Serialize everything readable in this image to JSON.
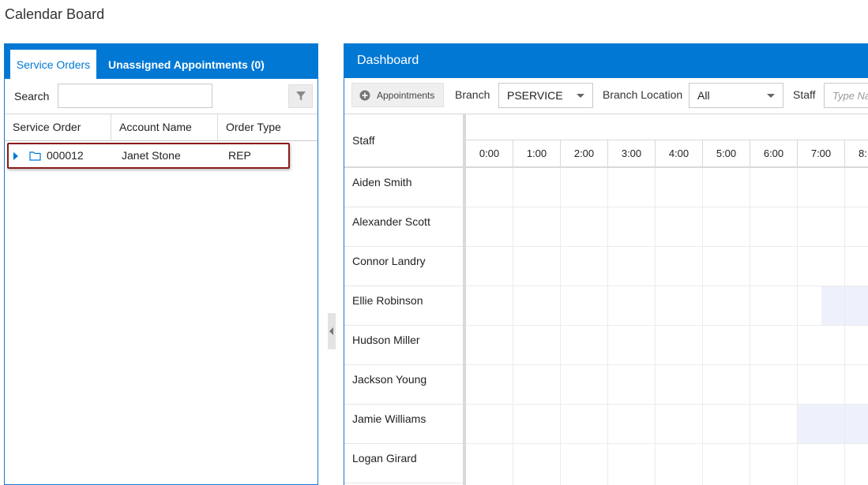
{
  "page": {
    "title": "Calendar Board"
  },
  "left_panel": {
    "tabs": [
      {
        "label": "Service Orders",
        "active": true
      },
      {
        "label": "Unassigned Appointments (0)",
        "active": false
      }
    ],
    "search": {
      "label": "Search",
      "value": ""
    },
    "columns": [
      "Service Order",
      "Account Name",
      "Order Type"
    ],
    "rows": [
      {
        "service_order": "000012",
        "account_name": "Janet Stone",
        "order_type": "REP"
      }
    ]
  },
  "dashboard": {
    "title": "Dashboard",
    "toolbar": {
      "appointments_label": "Appointments",
      "branch_label": "Branch",
      "branch_value": "PSERVICE",
      "branch_location_label": "Branch Location",
      "branch_location_value": "All",
      "staff_label": "Staff",
      "staff_placeholder": "Type Na"
    },
    "staff_header": "Staff",
    "hours": [
      "0:00",
      "1:00",
      "2:00",
      "3:00",
      "4:00",
      "5:00",
      "6:00",
      "7:00",
      "8:"
    ],
    "staff": [
      "Aiden Smith",
      "Alexander Scott",
      "Connor Landry",
      "Ellie Robinson",
      "Hudson Miller",
      "Jackson Young",
      "Jamie Williams",
      "Logan Girard"
    ]
  },
  "colors": {
    "accent": "#0078d4",
    "highlight_border": "#8b1a1a",
    "slot_shade": "#eef0fb"
  }
}
